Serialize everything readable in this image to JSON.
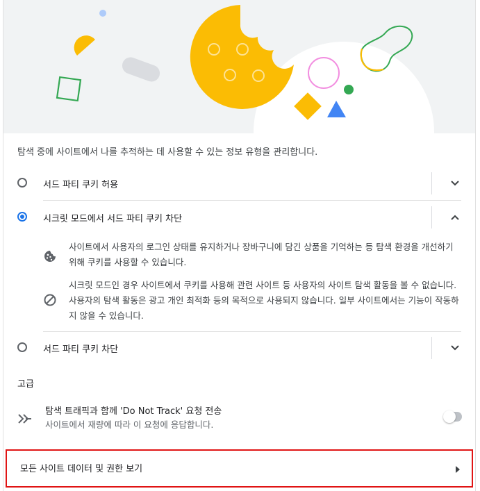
{
  "description": "탐색 중에 사이트에서 나를 추적하는 데 사용할 수 있는 정보 유형을 관리합니다.",
  "options": [
    {
      "label": "서드 파티 쿠키 허용",
      "selected": false,
      "expanded": false
    },
    {
      "label": "시크릿 모드에서 서드 파티 쿠키 차단",
      "selected": true,
      "expanded": true
    },
    {
      "label": "서드 파티 쿠키 차단",
      "selected": false,
      "expanded": false
    }
  ],
  "details": [
    {
      "icon": "cookie-icon",
      "text": "사이트에서 사용자의 로그인 상태를 유지하거나 장바구니에 담긴 상품을 기억하는 등 탐색 환경을 개선하기 위해 쿠키를 사용할 수 있습니다."
    },
    {
      "icon": "block-icon",
      "text": "시크릿 모드인 경우 사이트에서 쿠키를 사용해 관련 사이트 등 사용자의 사이트 탐색 활동을 볼 수 없습니다. 사용자의 탐색 활동은 광고 개인 최적화 등의 목적으로 사용되지 않습니다. 일부 사이트에서는 기능이 작동하지 않을 수 있습니다."
    }
  ],
  "advanced": {
    "title": "고급",
    "dnt_title": "탐색 트래픽과 함께 'Do Not Track' 요청 전송",
    "dnt_subtitle": "사이트에서 재량에 따라 이 요청에 응답합니다.",
    "dnt_enabled": false
  },
  "all_site_data_link": "모든 사이트 데이터 및 권한 보기",
  "colors": {
    "accent": "#1a73e8",
    "highlight_border": "#e01414",
    "cookie": "#fbbc04",
    "illustration_green": "#34a853",
    "illustration_blue": "#4285f4"
  }
}
